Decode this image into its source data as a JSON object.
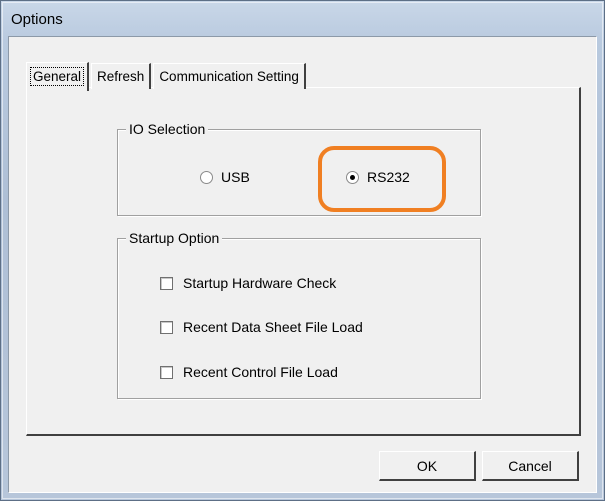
{
  "window": {
    "title": "Options"
  },
  "tabs": [
    {
      "label": "General",
      "active": true
    },
    {
      "label": "Refresh",
      "active": false
    },
    {
      "label": "Communication Setting",
      "active": false
    }
  ],
  "io_selection": {
    "label": "IO Selection",
    "options": [
      {
        "label": "USB",
        "checked": false
      },
      {
        "label": "RS232",
        "checked": true
      }
    ],
    "highlight_color": "#f07f22"
  },
  "startup_option": {
    "label": "Startup Option",
    "checkboxes": [
      {
        "label": "Startup Hardware Check",
        "checked": false
      },
      {
        "label": "Recent Data Sheet File Load",
        "checked": false
      },
      {
        "label": "Recent Control File Load",
        "checked": false
      }
    ]
  },
  "buttons": {
    "ok": "OK",
    "cancel": "Cancel"
  }
}
